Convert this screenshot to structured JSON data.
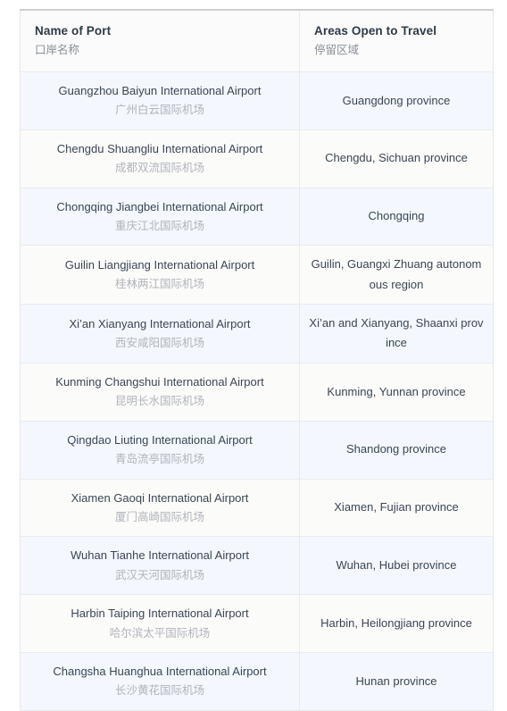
{
  "table": {
    "columns": [
      {
        "header_en": "Name of Port",
        "header_cn": "口岸名称"
      },
      {
        "header_en": "Areas Open to Travel",
        "header_cn": "停留区域"
      }
    ],
    "rows": [
      {
        "port_en": "Guangzhou Baiyun International Airport",
        "port_cn": "广州白云国际机场",
        "areas": "Guangdong province"
      },
      {
        "port_en": "Chengdu Shuangliu International Airport",
        "port_cn": "成都双流国际机场",
        "areas": "Chengdu, Sichuan province"
      },
      {
        "port_en": "Chongqing Jiangbei International Airport",
        "port_cn": "重庆江北国际机场",
        "areas": "Chongqing"
      },
      {
        "port_en": "Guilin Liangjiang International Airport",
        "port_cn": "桂林两江国际机场",
        "areas": "Guilin, Guangxi Zhuang autonomous region"
      },
      {
        "port_en": "Xi’an Xianyang International Airport",
        "port_cn": "西安咸阳国际机场",
        "areas": "Xi’an and Xianyang, Shaanxi province"
      },
      {
        "port_en": "Kunming Changshui International Airport",
        "port_cn": "昆明长水国际机场",
        "areas": "Kunming, Yunnan province"
      },
      {
        "port_en": "Qingdao Liuting International Airport",
        "port_cn": "青岛流亭国际机场",
        "areas": "Shandong province"
      },
      {
        "port_en": "Xiamen Gaoqi International Airport",
        "port_cn": "厦门高崎国际机场",
        "areas": "Xiamen, Fujian province"
      },
      {
        "port_en": "Wuhan Tianhe International Airport",
        "port_cn": "武汉天河国际机场",
        "areas": "Wuhan, Hubei province"
      },
      {
        "port_en": "Harbin Taiping International Airport",
        "port_cn": "哈尔滨太平国际机场",
        "areas": "Harbin, Heilongjiang province"
      },
      {
        "port_en": "Changsha Huanghua International Airport",
        "port_cn": "长沙黄花国际机场",
        "areas": "Hunan province"
      }
    ]
  },
  "colors": {
    "header_text": "#2e3a46",
    "header_subtext": "#8a9099",
    "row_text": "#3b4654",
    "row_subtext": "#b0b4ba",
    "row_odd_bg": "#f4f7fd",
    "row_even_bg": "#fbfbfa",
    "border": "#e8eaed",
    "top_border": "#cfcfcf"
  }
}
